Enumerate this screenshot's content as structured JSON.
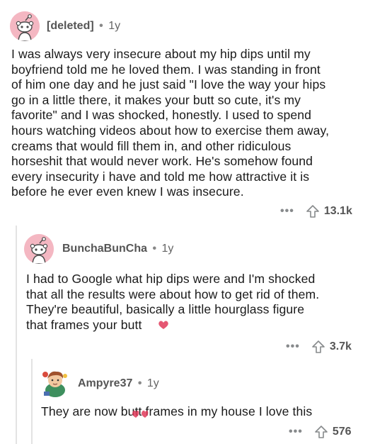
{
  "comments": [
    {
      "username": "[deleted]",
      "separator": "•",
      "age": "1y",
      "body_lines": [
        "I was always very insecure about my hip dips until my",
        "boyfriend told me he loved them. I was standing in front",
        "of him one day and he just said \"I love the way your hips",
        "go in a little there, it makes your butt so cute, it's my",
        "favorite\" and I was shocked, honestly. I used to spend",
        "hours watching videos about how to exercise them away,",
        "creams that would fill them in, and other ridiculous",
        "horseshit that would never work. He's somehow found",
        "every insecurity i have and told me how attractive it is",
        "before he ever even knew I was insecure."
      ],
      "more": "•••",
      "score": "13.1k"
    },
    {
      "username": "BunchaBunCha",
      "separator": "•",
      "age": "1y",
      "body_lines": [
        "I had to Google what hip dips were and I'm shocked",
        "that all the results were about how to get rid of them.",
        "They're beautiful, basically a little hourglass figure",
        "that frames your butt"
      ],
      "more": "•••",
      "score": "3.7k"
    },
    {
      "username": "Ampyre37",
      "separator": "•",
      "age": "1y",
      "body_lines": [
        "They are now butt frames in my house I love this"
      ],
      "more": "•••",
      "score": "576"
    }
  ],
  "colors": {
    "avatar_bg": "#f4b7c2",
    "thread_line": "#e3e3e3",
    "meta_text": "#555555",
    "action_gray": "#878a8c",
    "doodle_red": "#e03a5a"
  },
  "icons": {
    "avatar_default": "snoo-avatar-icon",
    "avatar_custom": "custom-avatar-icon",
    "upvote": "upvote-arrow-icon",
    "more": "more-options-icon"
  }
}
